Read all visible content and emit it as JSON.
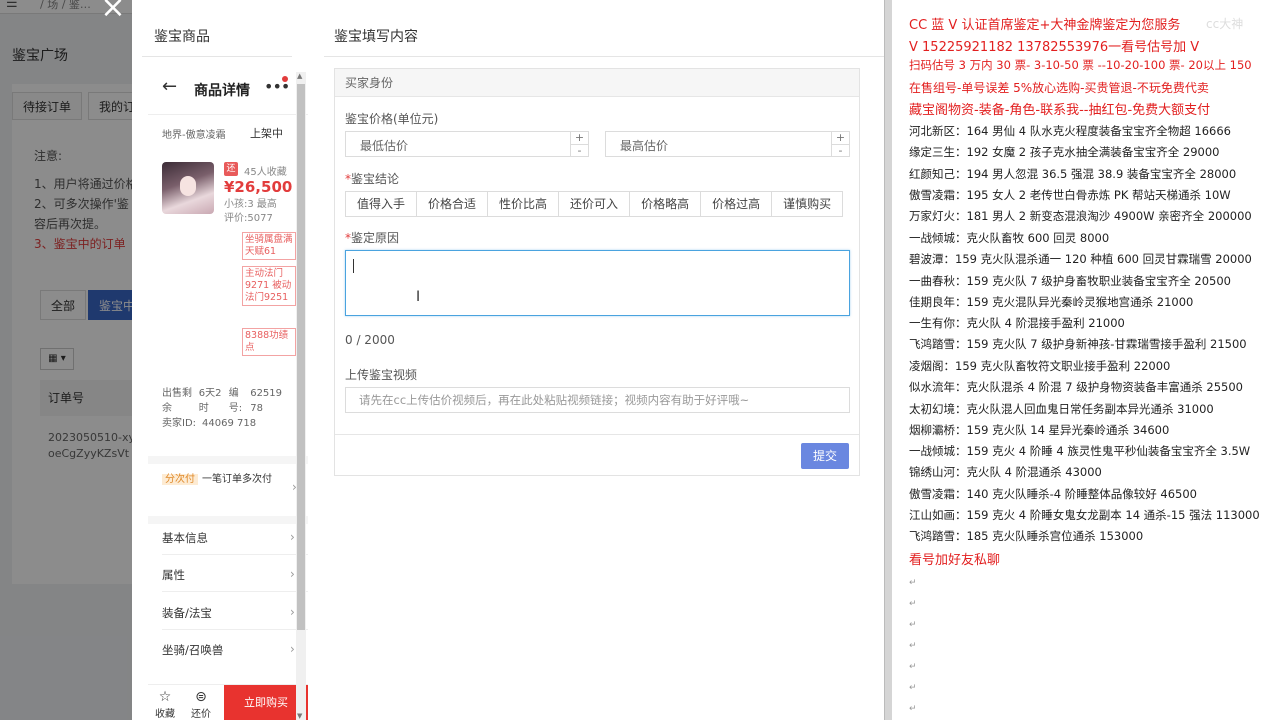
{
  "background": {
    "breadcrumb": "/  场  /  鉴…",
    "page_title": "鉴宝广场",
    "tabs": [
      "待接订单",
      "我的订"
    ],
    "notice_title": "注意:",
    "notice_lines": [
      "1、用户将通过价格",
      "2、可多次操作'鉴",
      "容后再次提。"
    ],
    "notice_red": "3、鉴宝中的订单",
    "filters": [
      "全部",
      "鉴宝中"
    ],
    "table_header": "订单号",
    "table_cell": "2023050510-xy01-oeCgZyyKZsVt"
  },
  "modal": {
    "left_heading": "鉴宝商品",
    "right_heading": "鉴宝填写内容",
    "close_label": "×"
  },
  "phone": {
    "title": "商品详情",
    "server": "地界-傲意凌霜",
    "status": "上架中",
    "fan_tag": "还",
    "favorites": "45人收藏",
    "price": "¥26,500",
    "small_line1": "小孩:3 最高",
    "small_line2": "评价:5077",
    "badges": [
      "坐骑属盘满天赋61",
      "主动法门9271 被动法门9251",
      "8388功绩点"
    ],
    "meta": [
      {
        "k": "出售剩余",
        "v": "6天2时",
        "k2": "编号:",
        "v2": "62519 78"
      },
      {
        "k": "卖家ID:",
        "v": "44069 718"
      }
    ],
    "installment_tag": "分次付",
    "installment_text": "一笔订单多次付",
    "rows": [
      "基本信息",
      "属性",
      "装备/法宝",
      "坐骑/召唤兽"
    ],
    "bottom_fav": "收藏",
    "bottom_bargain": "还价",
    "buy": "立即购买"
  },
  "form": {
    "section": "买家身份",
    "price_label": "鉴宝价格(单位元)",
    "min_placeholder": "最低估价",
    "max_placeholder": "最高估价",
    "conclusion_label": "鉴宝结论",
    "conclusions": [
      "值得入手",
      "价格合适",
      "性价比高",
      "还价可入",
      "价格略高",
      "价格过高",
      "谨慎购买"
    ],
    "reason_label": "鉴定原因",
    "counter": "0 / 2000",
    "video_label": "上传鉴宝视频",
    "video_placeholder": "请先在cc上传估价视频后，再在此处粘贴视频链接；视频内容有助于好评哦~",
    "submit": "提交"
  },
  "doc": {
    "red_lines": [
      "CC 蓝 V 认证首席鉴定+大神金牌鉴定为您服务",
      "V 15225921182      13782553976一看号估号加 V",
      "扫码估号 3 万内 30 票- 3-10-50 票  --10-20-100 票- 20以上 150",
      "在售组号-单号误差 5%放心选购-买贵管退-不玩免费代卖",
      "藏宝阁物资-装备-角色-联系我--抽红包-免费大额支付"
    ],
    "black_lines": [
      "河北新区：164 男仙 4 队水克火程度装备宝宝齐全物超 16666",
      "缘定三生：192 女魔 2 孩子克水抽全满装备宝宝齐全 29000",
      "红颜知己：194 男人忽混 36.5 强混 38.9 装备宝宝齐全 28000",
      "傲雪凌霜：195 女人 2 老传世白骨赤炼 PK 帮站天梯通杀 10W",
      "万家灯火：181 男人 2 新变态混浪淘沙 4900W 亲密齐全 200000",
      "一战倾城：克火队畜牧 600 回灵 8000",
      "碧波潭：159 克火队混杀通一 120 种植 600 回灵甘霖瑞雪 20000",
      "一曲春秋：159 克火队 7 级护身畜牧职业装备宝宝齐全 20500",
      "佳期良年：159 克火混队异光秦岭灵猴地宫通杀 21000",
      "一生有你：克火队 4 阶混接手盈利 21000",
      "飞鸿踏雪：159 克火队 7 级护身新神孩-甘霖瑞雪接手盈利 21500",
      "凌烟阁：159 克火队畜牧符文职业接手盈利 22000",
      "似水流年：克火队混杀 4 阶混 7 级护身物资装备丰富通杀 25500",
      "太初幻境：克火队混人回血鬼日常任务副本异光通杀 31000",
      "烟柳灞桥：159 克火队 14 星异光秦岭通杀 34600",
      "一战倾城：159 克火 4 阶睡 4 族灵性鬼平秒仙装备宝宝齐全 3.5W",
      "锦绣山河：克火队 4 阶混通杀 43000",
      "傲雪凌霜：140 克火队睡杀-4 阶睡整体品像较好 46500",
      "江山如画：159 克火 4 阶睡女鬼女龙副本 14 通杀-15 强法 113000",
      "飞鸿踏雪：185 克火队睡杀宫位通杀 153000"
    ],
    "footer_red": "看号加好友私聊",
    "watermark": "cc大神"
  }
}
